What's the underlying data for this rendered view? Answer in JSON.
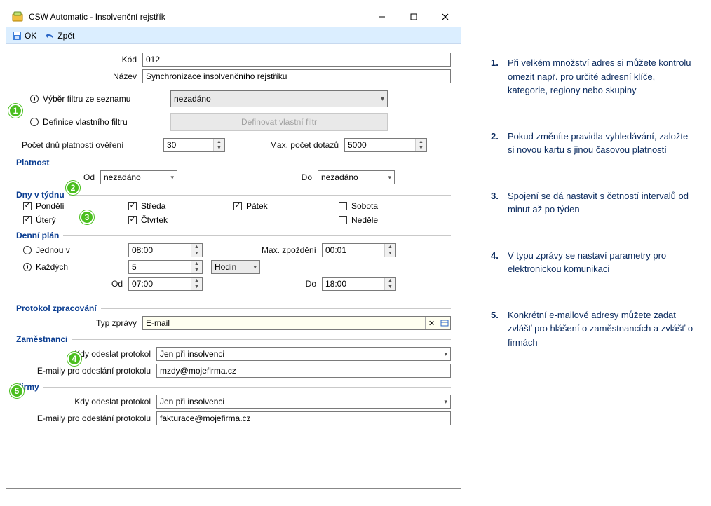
{
  "window": {
    "title": "CSW Automatic - Insolvenční rejstřík"
  },
  "toolbar": {
    "ok": "OK",
    "back": "Zpět"
  },
  "form": {
    "kod_label": "Kód",
    "kod_value": "012",
    "nazev_label": "Název",
    "nazev_value": "Synchronizace insolvenčního rejstříku",
    "filter_list_radio": "Výběr filtru ze seznamu",
    "filter_own_radio": "Definice vlastního filtru",
    "filter_select_value": "nezadáno",
    "define_own_filter_btn": "Definovat vlastní filtr",
    "days_valid_label": "Počet dnů platnosti ověření",
    "days_valid_value": "30",
    "max_queries_label": "Max. počet dotazů",
    "max_queries_value": "5000"
  },
  "platnost": {
    "header": "Platnost",
    "od_label": "Od",
    "od_value": "nezadáno",
    "do_label": "Do",
    "do_value": "nezadáno"
  },
  "days": {
    "header": "Dny v týdnu",
    "mon": "Pondělí",
    "tue": "Úterý",
    "wed": "Středa",
    "thu": "Čtvrtek",
    "fri": "Pátek",
    "sat": "Sobota",
    "sun": "Neděle"
  },
  "daily": {
    "header": "Denní plán",
    "once_label": "Jednou v",
    "once_value": "08:00",
    "max_delay_label": "Max. zpoždění",
    "max_delay_value": "00:01",
    "every_label": "Každých",
    "every_value": "5",
    "unit_value": "Hodin",
    "od_label": "Od",
    "od_value": "07:00",
    "do_label": "Do",
    "do_value": "18:00"
  },
  "protocol": {
    "header": "Protokol zpracování",
    "type_label": "Typ zprávy",
    "type_value": "E-mail",
    "employees_header": "Zaměstnanci",
    "when_send_label": "Kdy odeslat protokol",
    "when_send_value_emp": "Jen při insolvenci",
    "emails_label": "E-maily pro odeslání protokolu",
    "emails_emp_value": "mzdy@mojefirma.cz",
    "companies_header": "Firmy",
    "when_send_value_comp": "Jen při insolvenci",
    "emails_comp_value": "fakturace@mojefirma.cz"
  },
  "notes": [
    {
      "n": "1.",
      "t": "Při velkém množství adres si můžete kontrolu omezit např. pro určité adresní klíče, kategorie, regiony nebo skupiny"
    },
    {
      "n": "2.",
      "t": "Pokud změníte pravidla vyhledávání, založte si novou kartu s jinou časovou platností"
    },
    {
      "n": "3.",
      "t": "Spojení se dá nastavit s četností intervalů od minut až po týden"
    },
    {
      "n": "4.",
      "t": "V typu zprávy se nastaví parametry pro elektronickou komunikaci"
    },
    {
      "n": "5.",
      "t": "Konkrétní e-mailové adresy můžete zadat zvlášť pro hlášení o zaměstnancích a zvlášť o firmách"
    }
  ],
  "markers": [
    "1",
    "2",
    "3",
    "4",
    "5"
  ]
}
